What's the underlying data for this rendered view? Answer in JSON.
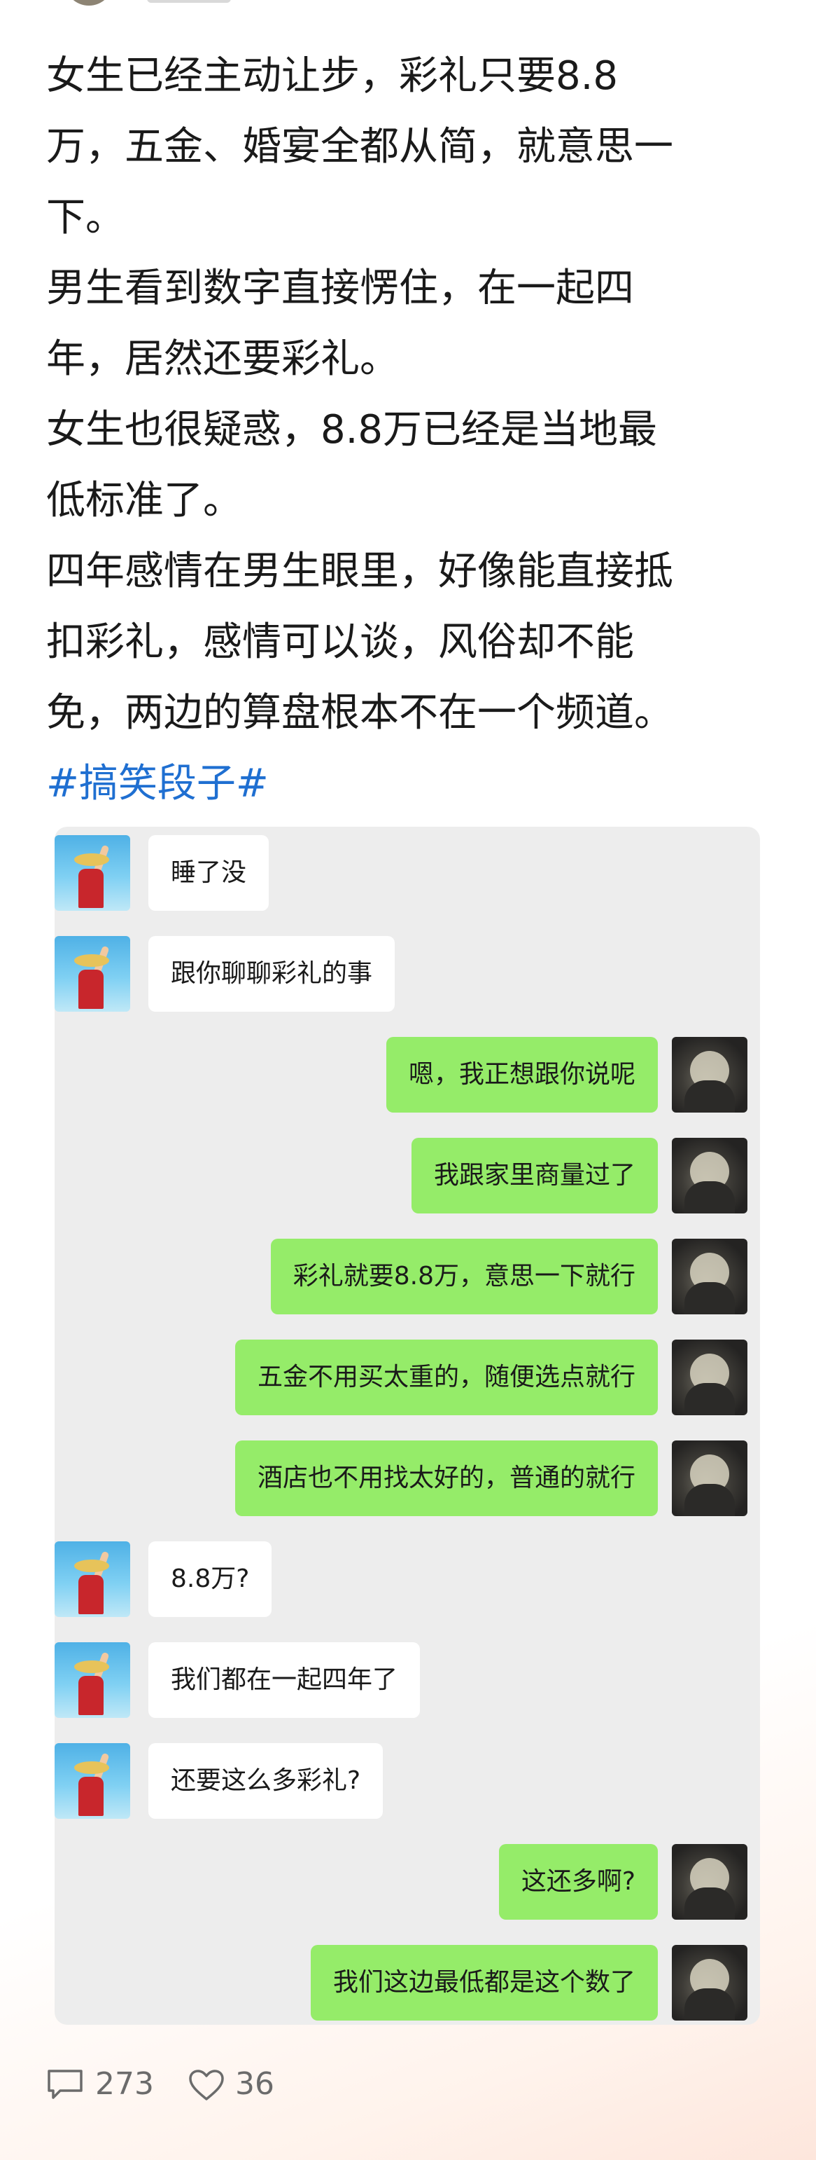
{
  "post": {
    "lines": [
      "女生已经主动让步，彩礼只要8.8",
      "万，五金、婚宴全都从简，就意思一",
      "下。",
      "男生看到数字直接愣住，在一起四",
      "年，居然还要彩礼。",
      "女生也很疑惑，8.8万已经是当地最",
      "低标准了。",
      "四年感情在男生眼里，好像能直接抵",
      "扣彩礼，感情可以谈，风俗却不能",
      "免，两边的算盘根本不在一个频道。"
    ],
    "hashtag": "#搞笑段子#"
  },
  "chat": {
    "messages": [
      {
        "side": "left",
        "text": "睡了没"
      },
      {
        "side": "left",
        "text": "跟你聊聊彩礼的事"
      },
      {
        "side": "right",
        "text": "嗯，我正想跟你说呢"
      },
      {
        "side": "right",
        "text": "我跟家里商量过了"
      },
      {
        "side": "right",
        "text": "彩礼就要8.8万，意思一下就行"
      },
      {
        "side": "right",
        "text": "五金不用买太重的，随便选点就行"
      },
      {
        "side": "right",
        "text": "酒店也不用找太好的，普通的就行"
      },
      {
        "side": "left",
        "text": "8.8万?"
      },
      {
        "side": "left",
        "text": "我们都在一起四年了"
      },
      {
        "side": "left",
        "text": "还要这么多彩礼?"
      },
      {
        "side": "right",
        "text": "这还多啊?"
      },
      {
        "side": "right",
        "text": "我们这边最低都是这个数了"
      }
    ],
    "colors": {
      "self_bubble": "#95ec69",
      "other_bubble": "#ffffff",
      "background": "#ededed"
    }
  },
  "footer": {
    "comment_icon": "comment-icon",
    "comment_count": "273",
    "like_icon": "heart-icon",
    "like_count": "36"
  },
  "accent_color": "#1f6fd1"
}
